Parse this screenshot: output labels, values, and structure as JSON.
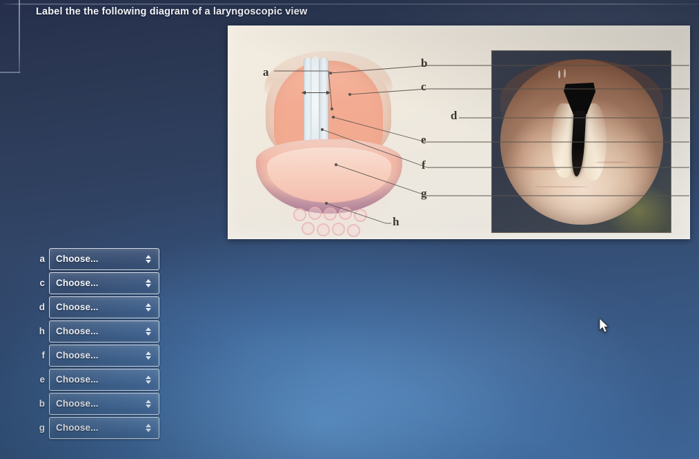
{
  "question": {
    "title": "Label the the following diagram of a laryngoscopic view"
  },
  "figure": {
    "labels": [
      {
        "id": "a",
        "text": "a"
      },
      {
        "id": "b",
        "text": "b"
      },
      {
        "id": "c",
        "text": "c"
      },
      {
        "id": "d",
        "text": "d"
      },
      {
        "id": "e",
        "text": "e"
      },
      {
        "id": "f",
        "text": "f"
      },
      {
        "id": "g",
        "text": "g"
      },
      {
        "id": "h",
        "text": "h"
      }
    ],
    "illustration_alt": "anatomical drawing of the larynx viewed from above",
    "photo_alt": "endoscopic photograph of the larynx and vocal folds"
  },
  "answers": {
    "placeholder": "Choose...",
    "rows": [
      {
        "letter": "a",
        "value": "Choose..."
      },
      {
        "letter": "c",
        "value": "Choose..."
      },
      {
        "letter": "d",
        "value": "Choose..."
      },
      {
        "letter": "h",
        "value": "Choose..."
      },
      {
        "letter": "f",
        "value": "Choose..."
      },
      {
        "letter": "e",
        "value": "Choose..."
      },
      {
        "letter": "b",
        "value": "Choose..."
      },
      {
        "letter": "g",
        "value": "Choose..."
      }
    ]
  },
  "colors": {
    "background_dark": "#252f4c",
    "background_light": "#3f6798",
    "panel_background": "#f0eade",
    "text_light": "#f2f4f8",
    "label_text": "#3b3730"
  }
}
